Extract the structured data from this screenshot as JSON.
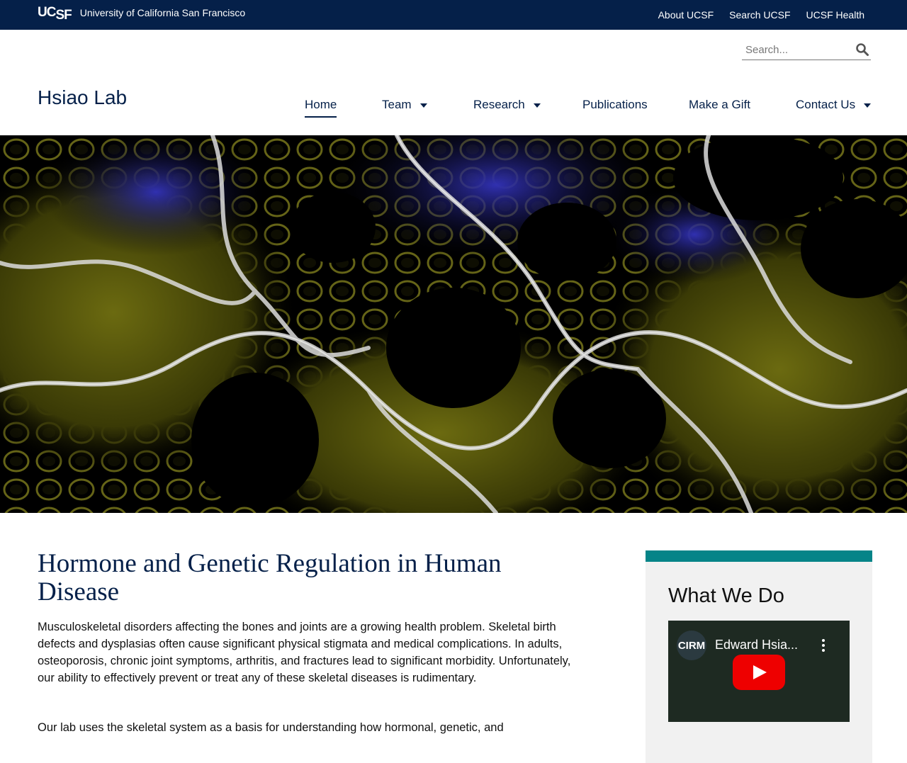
{
  "topbar": {
    "logo_text": "UCSF",
    "university": "University of California San Francisco",
    "links": [
      "About UCSF",
      "Search UCSF",
      "UCSF Health"
    ]
  },
  "search": {
    "placeholder": "Search..."
  },
  "site": {
    "name": "Hsiao Lab"
  },
  "nav": {
    "items": [
      {
        "label": "Home",
        "active": true,
        "dropdown": false
      },
      {
        "label": "Team",
        "active": false,
        "dropdown": true
      },
      {
        "label": "Research",
        "active": false,
        "dropdown": true
      },
      {
        "label": "Publications",
        "active": false,
        "dropdown": false
      },
      {
        "label": "Make a Gift",
        "active": false,
        "dropdown": false
      },
      {
        "label": "Contact Us",
        "active": false,
        "dropdown": true
      }
    ]
  },
  "main": {
    "title": "Hormone and Genetic Regulation in Human Disease",
    "paragraphs": [
      "Musculoskeletal disorders affecting the bones and joints are a growing health problem. Skeletal birth defects and dysplasias often cause significant physical stigmata and medical complications. In adults, osteoporosis, chronic joint symptoms, arthritis, and fractures lead to significant morbidity. Unfortunately, our ability to effectively prevent or treat any of these skeletal diseases is rudimentary.",
      "Our lab uses the skeletal system as a basis for understanding how hormonal, genetic, and"
    ]
  },
  "sidebar": {
    "heading": "What We Do",
    "video": {
      "title": "Edward Hsia...",
      "channel_badge": "CIRM"
    }
  },
  "colors": {
    "navy": "#052049",
    "teal": "#058488",
    "play_red": "#e00"
  }
}
